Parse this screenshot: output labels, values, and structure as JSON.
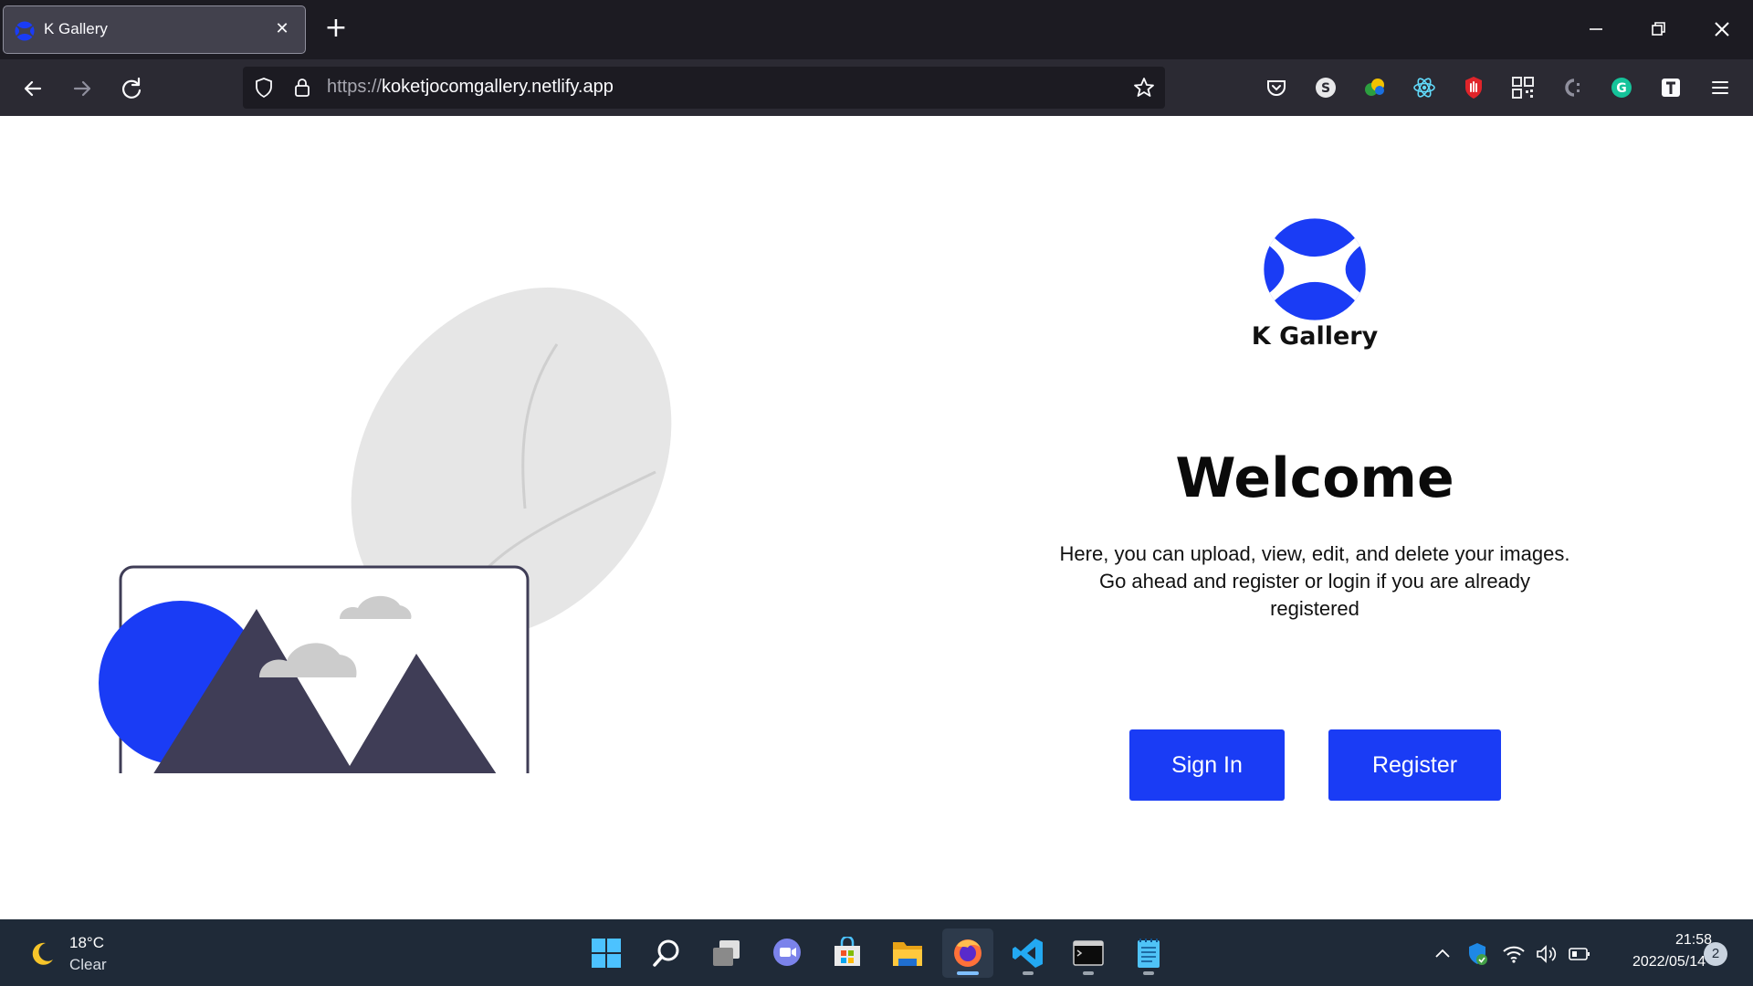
{
  "browser": {
    "tab": {
      "title": "K Gallery",
      "close_glyph": "✕"
    },
    "new_tab_glyph": "+",
    "url": {
      "scheme": "https://",
      "host": "koketjocomgallery.netlify.app"
    },
    "icons": {
      "back": "back-arrow-icon",
      "forward": "forward-arrow-icon",
      "reload": "reload-icon",
      "tracking_protection": "shield-icon",
      "secure": "lock-icon",
      "bookmark": "star-icon",
      "menu": "hamburger-menu-icon"
    },
    "extensions": [
      "pocket-icon",
      "s-extension-icon",
      "colorful-extension-icon",
      "react-devtools-icon",
      "red-hand-icon",
      "qr-code-icon",
      "c-extension-icon",
      "grammarly-icon",
      "t-extension-icon"
    ]
  },
  "page": {
    "brand": {
      "name": "K Gallery"
    },
    "welcome": {
      "title": "Welcome",
      "line1": "Here, you can upload, view, edit, and delete your images.",
      "line2": "Go ahead and register or login if you are already",
      "line3": "registered"
    },
    "buttons": {
      "signin": "Sign In",
      "register": "Register"
    },
    "colors": {
      "accent": "#1a3cf5",
      "mountain": "#3f3d56",
      "cloud": "#cccccc",
      "leaf": "#e6e6e6"
    }
  },
  "taskbar": {
    "weather": {
      "temp": "18°C",
      "condition": "Clear"
    },
    "apps": [
      "windows-start-icon",
      "search-icon",
      "task-view-icon",
      "teams-chat-icon",
      "microsoft-store-icon",
      "file-explorer-icon",
      "firefox-icon",
      "vscode-icon",
      "terminal-icon",
      "notepad-icon"
    ],
    "tray": [
      "chevron-up-icon",
      "defender-shield-icon",
      "wifi-icon",
      "speaker-icon",
      "battery-icon"
    ],
    "clock": {
      "time": "21:58",
      "date": "2022/05/14"
    },
    "notifications": "2"
  }
}
